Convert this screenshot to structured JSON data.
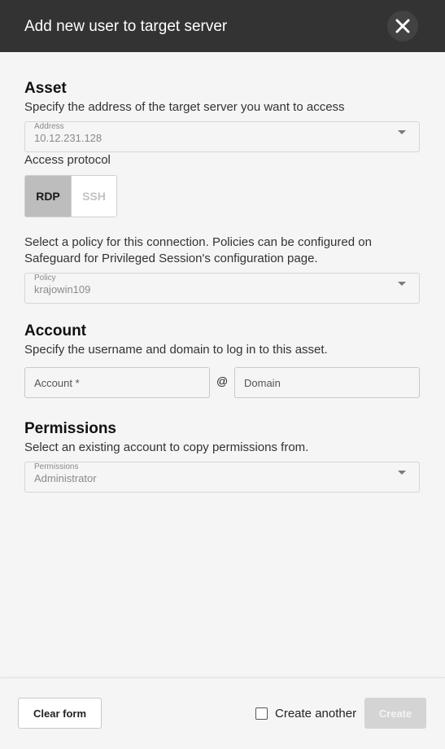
{
  "header": {
    "title": "Add new user to target server",
    "close_icon": "close-icon"
  },
  "asset": {
    "title": "Asset",
    "description": "Specify the address of the target server you want to access",
    "address": {
      "label": "Address",
      "value": "10.12.231.128"
    },
    "protocol_label": "Access protocol",
    "protocols": [
      {
        "label": "RDP",
        "selected": true
      },
      {
        "label": "SSH",
        "selected": false
      }
    ],
    "policy_description_line1": "Select a policy for this connection. Policies can be configured on",
    "policy_description_line2": "Safeguard for Privileged Session's configuration page.",
    "policy": {
      "label": "Policy",
      "value": "krajowin109"
    }
  },
  "account": {
    "title": "Account",
    "description": "Specify the username and domain to log in to this asset.",
    "account_placeholder": "Account *",
    "separator": "@",
    "domain_placeholder": "Domain"
  },
  "permissions": {
    "title": "Permissions",
    "description": "Select an existing account to copy permissions from.",
    "select": {
      "label": "Permissions",
      "value": "Administrator"
    }
  },
  "footer": {
    "clear_label": "Clear form",
    "create_another_label": "Create another",
    "create_another_checked": false,
    "create_label": "Create"
  },
  "colors": {
    "header_bg": "#333333",
    "page_bg": "#f5f5f5",
    "selected_toggle": "#bdbdbd",
    "disabled_button": "#d4d4d4"
  }
}
